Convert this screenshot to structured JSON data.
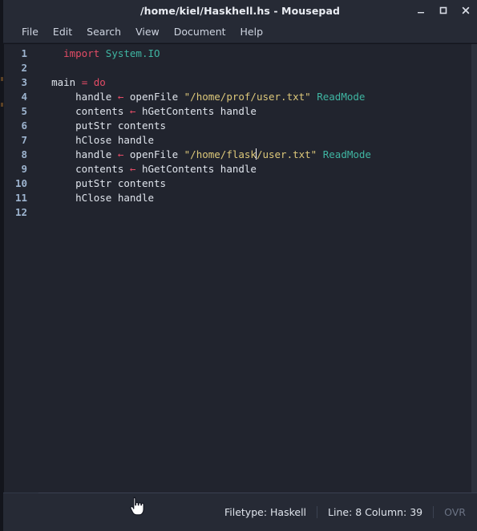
{
  "window": {
    "title": "/home/kiel/Haskhell.hs - Mousepad",
    "controls": {
      "minimize": "minimize-button",
      "maximize": "maximize-button",
      "close": "close-button"
    }
  },
  "menubar": {
    "items": [
      {
        "label": "File"
      },
      {
        "label": "Edit"
      },
      {
        "label": "Search"
      },
      {
        "label": "View"
      },
      {
        "label": "Document"
      },
      {
        "label": "Help"
      }
    ]
  },
  "editor": {
    "line_numbers": [
      "1",
      "2",
      "3",
      "4",
      "5",
      "6",
      "7",
      "8",
      "9",
      "10",
      "11",
      "12"
    ],
    "lines": [
      {
        "n": 1,
        "tokens": [
          {
            "t": "    ",
            "c": "plain"
          },
          {
            "t": "import",
            "c": "kw"
          },
          {
            "t": " ",
            "c": "plain"
          },
          {
            "t": "System.IO",
            "c": "type"
          }
        ]
      },
      {
        "n": 2,
        "tokens": []
      },
      {
        "n": 3,
        "tokens": [
          {
            "t": "  ",
            "c": "plain"
          },
          {
            "t": "main",
            "c": "plain"
          },
          {
            "t": " ",
            "c": "plain"
          },
          {
            "t": "=",
            "c": "op"
          },
          {
            "t": " ",
            "c": "plain"
          },
          {
            "t": "do",
            "c": "kw"
          }
        ]
      },
      {
        "n": 4,
        "tokens": [
          {
            "t": "      ",
            "c": "plain"
          },
          {
            "t": "handle",
            "c": "plain"
          },
          {
            "t": " ",
            "c": "plain"
          },
          {
            "t": "←",
            "c": "op"
          },
          {
            "t": " openFile ",
            "c": "plain"
          },
          {
            "t": "\"/home/prof/user.txt\"",
            "c": "str"
          },
          {
            "t": " ",
            "c": "plain"
          },
          {
            "t": "ReadMode",
            "c": "type"
          }
        ]
      },
      {
        "n": 5,
        "tokens": [
          {
            "t": "      ",
            "c": "plain"
          },
          {
            "t": "contents",
            "c": "plain"
          },
          {
            "t": " ",
            "c": "plain"
          },
          {
            "t": "←",
            "c": "op"
          },
          {
            "t": " hGetContents handle",
            "c": "plain"
          }
        ]
      },
      {
        "n": 6,
        "tokens": [
          {
            "t": "      ",
            "c": "plain"
          },
          {
            "t": "putStr contents",
            "c": "plain"
          }
        ]
      },
      {
        "n": 7,
        "tokens": [
          {
            "t": "      ",
            "c": "plain"
          },
          {
            "t": "hClose handle",
            "c": "plain"
          }
        ]
      },
      {
        "n": 8,
        "tokens": [
          {
            "t": "      ",
            "c": "plain"
          },
          {
            "t": "handle",
            "c": "plain"
          },
          {
            "t": " ",
            "c": "plain"
          },
          {
            "t": "←",
            "c": "op"
          },
          {
            "t": " openFile ",
            "c": "plain"
          },
          {
            "t": "\"/home/flask",
            "c": "str"
          },
          {
            "t": "",
            "c": "caret"
          },
          {
            "t": "/user.txt\"",
            "c": "str"
          },
          {
            "t": " ",
            "c": "plain"
          },
          {
            "t": "ReadMode",
            "c": "type"
          }
        ]
      },
      {
        "n": 9,
        "tokens": [
          {
            "t": "      ",
            "c": "plain"
          },
          {
            "t": "contents",
            "c": "plain"
          },
          {
            "t": " ",
            "c": "plain"
          },
          {
            "t": "←",
            "c": "op"
          },
          {
            "t": " hGetContents handle",
            "c": "plain"
          }
        ]
      },
      {
        "n": 10,
        "tokens": [
          {
            "t": "      ",
            "c": "plain"
          },
          {
            "t": "putStr contents",
            "c": "plain"
          }
        ]
      },
      {
        "n": 11,
        "tokens": [
          {
            "t": "      ",
            "c": "plain"
          },
          {
            "t": "hClose handle",
            "c": "plain"
          }
        ]
      },
      {
        "n": 12,
        "tokens": []
      }
    ],
    "plain_text": [
      "    import System.IO",
      "",
      "  main = do",
      "      handle ← openFile \"/home/prof/user.txt\" ReadMode",
      "      contents ← hGetContents handle",
      "      putStr contents",
      "      hClose handle",
      "      handle ← openFile \"/home/flask/user.txt\" ReadMode",
      "      contents ← hGetContents handle",
      "      putStr contents",
      "      hClose handle",
      ""
    ]
  },
  "statusbar": {
    "filetype": "Filetype: Haskell",
    "position": "Line: 8 Column: 39",
    "overwrite_mode": "OVR"
  },
  "colors": {
    "titlebar_bg": "#262a35",
    "menubar_bg": "#262a35",
    "editor_bg": "#21242e",
    "statusbar_bg": "#262a35",
    "keyword": "#e44c66",
    "type": "#3fb5a2",
    "string": "#ddc87a",
    "plain_text": "#dfe4ec",
    "line_number": "#9db4cf",
    "status_dim": "#6b7384",
    "caret": "#ffffff"
  }
}
